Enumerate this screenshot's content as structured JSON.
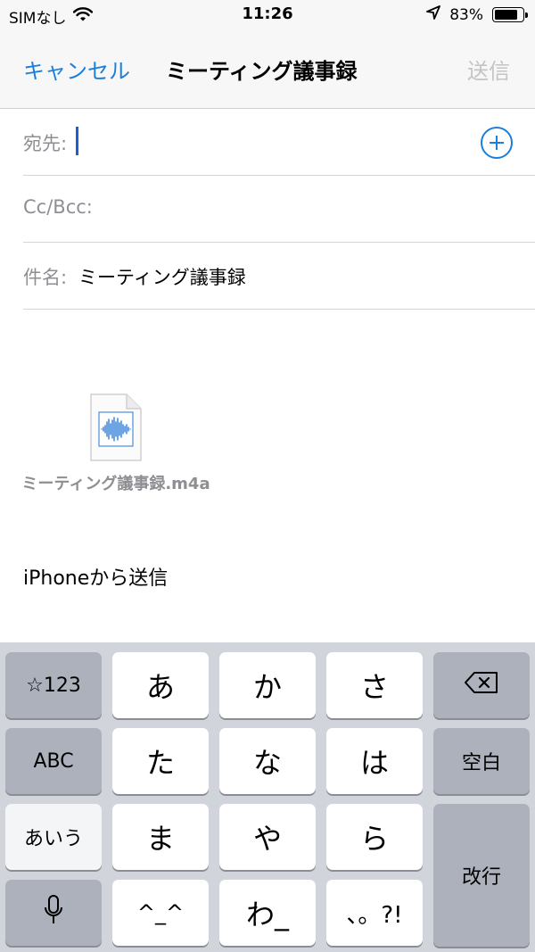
{
  "status_bar": {
    "carrier": "SIMなし",
    "time": "11:26",
    "battery_percent": "83%",
    "battery_level": 0.83,
    "icons": [
      "wifi-icon",
      "location-arrow-icon",
      "battery-icon"
    ]
  },
  "nav": {
    "cancel_label": "キャンセル",
    "title": "ミーティング議事録",
    "send_label": "送信"
  },
  "compose": {
    "to_label": "宛先:",
    "to_value": "",
    "cc_label": "Cc/Bcc:",
    "subject_label": "件名:",
    "subject_value": "ミーティング議事録"
  },
  "attachment": {
    "file_name": "ミーティング議事録.m4a",
    "icon": "audio-file-icon"
  },
  "body": {
    "signature": "iPhoneから送信"
  },
  "keyboard": {
    "keys": {
      "symbols": "☆123",
      "a": "あ",
      "ka": "か",
      "sa": "さ",
      "abc": "ABC",
      "ta": "た",
      "na": "な",
      "ha": "は",
      "space": "空白",
      "aiu": "あいう",
      "ma": "ま",
      "ya": "や",
      "ra": "ら",
      "enter": "改行",
      "emoticon": "^_^",
      "wa": "わ_",
      "punct": "、。?!"
    },
    "icons": [
      "delete-icon",
      "microphone-icon"
    ]
  },
  "colors": {
    "accent": "#1a7fdc",
    "disabled": "#c4c4c4",
    "label_gray": "#8e8e93",
    "keyboard_bg": "#d1d4da",
    "function_key": "#acb1bb"
  }
}
